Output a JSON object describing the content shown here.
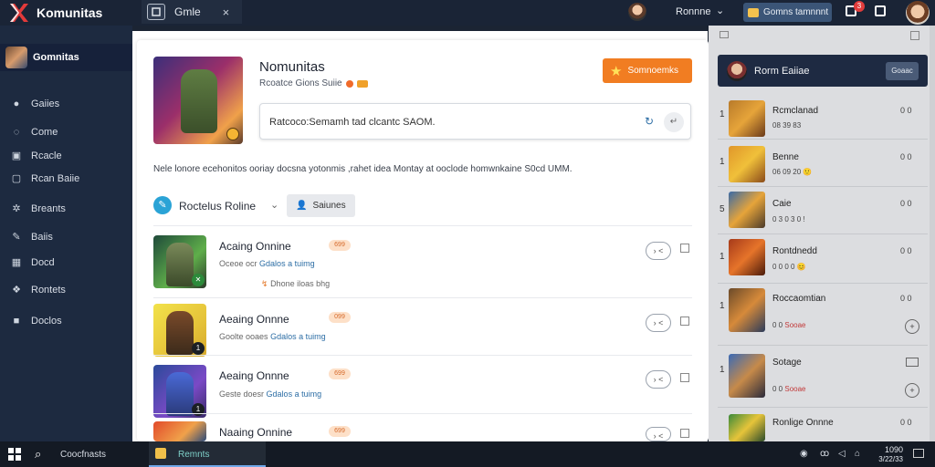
{
  "app": {
    "logo_text": "Komunitas",
    "tab_label": "Gmle",
    "tab_close": "×",
    "user_name": "Ronnne",
    "top_button": "Gomns tamnnnt",
    "notif_count": "3"
  },
  "sidebar": {
    "header": "Gomnitas",
    "items": [
      {
        "label": "Gaiies",
        "icon": "gamepad-icon"
      },
      {
        "label": "Come",
        "icon": "compass-icon"
      },
      {
        "label": "Rcacle",
        "icon": "book-icon"
      },
      {
        "label": "Rcan Baiie",
        "icon": "chat-icon"
      },
      {
        "label": "Breants",
        "icon": "users-icon"
      },
      {
        "label": "Baiis",
        "icon": "pen-icon"
      },
      {
        "label": "Docd",
        "icon": "calendar-icon"
      },
      {
        "label": "Rontets",
        "icon": "groups-icon"
      },
      {
        "label": "Doclos",
        "icon": "folder-icon"
      }
    ]
  },
  "hero": {
    "title": "Nomunitas",
    "subtitle": "Rcoatce Gions Suiie",
    "cta_label": "Somnoemks",
    "search_value": "Ratcoco:Semamh tad clcantc SAOM.",
    "description": "Nele lonore ecehonitos ooriay docsna yotonmis ,rahet idea Montay at ooclode homwnkaine S0cd UMM."
  },
  "filter": {
    "label": "Roctelus Roline",
    "chip_label": "Saiunes"
  },
  "rows": [
    {
      "title": "Acaing Onnine",
      "badge": "699",
      "meta": "Oceoe ocr",
      "meta_link": "Gdalos a tuimg",
      "extra": "Dhone iloas bhg",
      "play": "› <"
    },
    {
      "title": "Aeaing Onnne",
      "badge": "099",
      "meta": "Goolte ooaes",
      "meta_link": "Gdalos a tuimg",
      "extra": "",
      "play": "› <"
    },
    {
      "title": "Aeaing Onnne",
      "badge": "699",
      "meta": "Geste doesr",
      "meta_link": "Gdalos a tuimg",
      "extra": "",
      "play": "› <"
    },
    {
      "title": "Naaing Onnine",
      "badge": "699",
      "meta": "",
      "meta_link": "",
      "extra": "",
      "play": "› <"
    }
  ],
  "right_panel": {
    "title": "Rorm Eaiiae",
    "button": "Goaac",
    "items": [
      {
        "num": "1",
        "title": "Rcmclanad",
        "meta": "08 39 83",
        "highlight": "",
        "action": "0 0"
      },
      {
        "num": "1",
        "title": "Benne",
        "meta": "06 09 20 🙂",
        "highlight": "",
        "action": "0 0"
      },
      {
        "num": "5",
        "title": "Caie",
        "meta": "0 3 0 3 0 !",
        "highlight": "",
        "action": "0 0"
      },
      {
        "num": "1",
        "title": "Rontdnedd",
        "meta": "0 0 0 0 😊",
        "highlight": "",
        "action": "0 0"
      },
      {
        "num": "1",
        "title": "Roccaomtian",
        "meta": "0 0",
        "highlight": "Sooae",
        "action": "0 0"
      },
      {
        "num": "1",
        "title": "Sotage",
        "meta": "0 0",
        "highlight": "Sooae",
        "action": ""
      },
      {
        "num": "1",
        "title": "Ronlige Onnne",
        "meta": "",
        "highlight": "",
        "action": "0 0"
      }
    ]
  },
  "taskbar": {
    "search_label": "Coocfnasts",
    "app_label": "Remnts",
    "time": "1090",
    "date": "3/22/33"
  },
  "colors": {
    "accent_orange": "#f17d22",
    "sidebar_bg": "#1d2a40",
    "topbar_bg": "#1a2436",
    "link_blue": "#2d6ea5"
  }
}
